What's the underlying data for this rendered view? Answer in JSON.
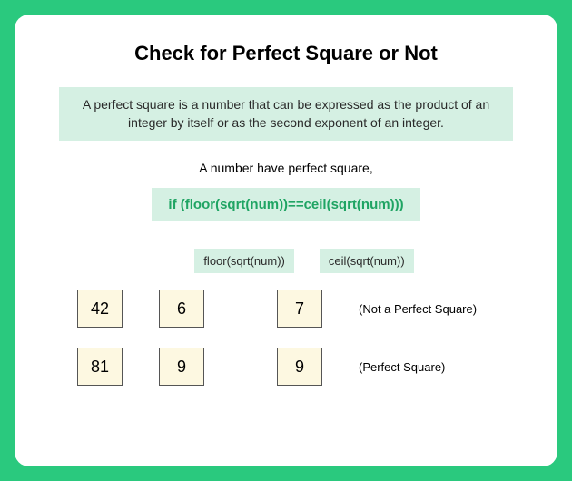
{
  "title": "Check for Perfect Square or Not",
  "definition": "A perfect square is a number that can be expressed as the product of an integer by itself or as the second exponent of an integer.",
  "subtitle": "A number have perfect square,",
  "condition": "if (floor(sqrt(num))==ceil(sqrt(num)))",
  "labels": {
    "floor": "floor(sqrt(num))",
    "ceil": "ceil(sqrt(num))"
  },
  "examples": [
    {
      "num": "42",
      "floor": "6",
      "ceil": "7",
      "result": "(Not a Perfect Square)"
    },
    {
      "num": "81",
      "floor": "9",
      "ceil": "9",
      "result": "(Perfect Square)"
    }
  ]
}
